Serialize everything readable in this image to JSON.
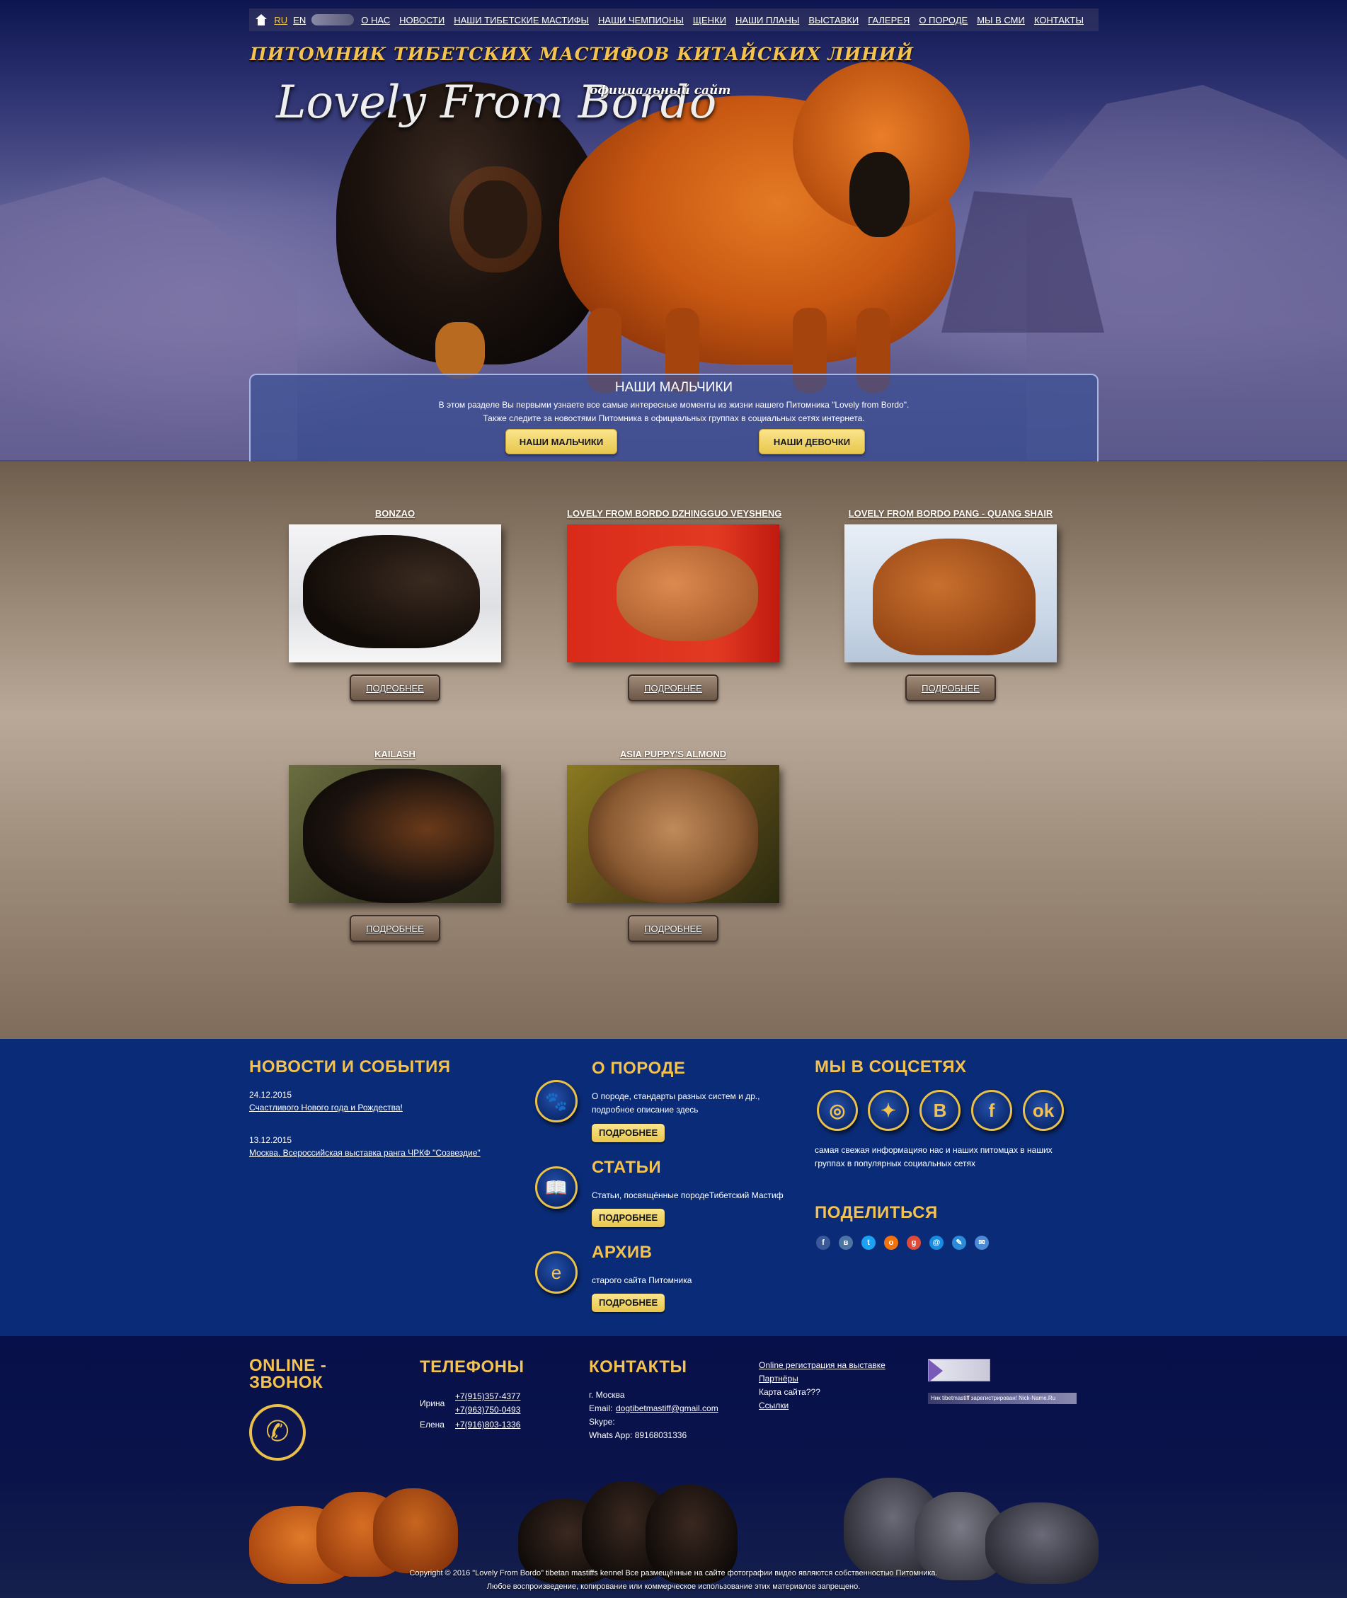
{
  "header": {
    "langs": [
      {
        "label": "RU",
        "active": true
      },
      {
        "label": "EN",
        "active": false
      }
    ],
    "nav": [
      "О НАС",
      "НОВОСТИ",
      "НАШИ ТИБЕТСКИЕ МАСТИФЫ",
      "НАШИ ЧЕМПИОНЫ",
      "ЩЕНКИ",
      "НАШИ ПЛАНЫ",
      "ВЫСТАВКИ",
      "ГАЛЕРЕЯ",
      "О ПОРОДЕ",
      "МЫ В СМИ",
      "КОНТАКТЫ"
    ],
    "kennel_title": "ПИТОМНИК ТИБЕТСКИХ МАСТИФОВ КИТАЙСКИХ ЛИНИЙ",
    "logo": "Lovely From Bordo",
    "official": "официальный сайт"
  },
  "intro": {
    "title": "НАШИ МАЛЬЧИКИ",
    "line1": "В этом разделе Вы первыми узнаете все самые интересные моменты из жизни нашего Питомника \"Lovely from Bordo\".",
    "line2": "Также следите за новостями Питомника в официальных группах в социальных сетях интернета.",
    "btn_boys": "НАШИ МАЛЬЧИКИ",
    "btn_girls": "НАШИ ДЕВОЧКИ"
  },
  "dogs": [
    {
      "name": "BONZAO",
      "more": "ПОДРОБНЕЕ"
    },
    {
      "name": "LOVELY FROM BORDO DZHINGGUO VEYSHENG",
      "more": "ПОДРОБНЕЕ"
    },
    {
      "name": "LOVELY FROM BORDO PANG - QUANG SHAIR",
      "more": "ПОДРОБНЕЕ"
    },
    {
      "name": "KAILASH",
      "more": "ПОДРОБНЕЕ"
    },
    {
      "name": "ASIA PUPPY'S ALMOND",
      "more": "ПОДРОБНЕЕ"
    }
  ],
  "news": {
    "title": "НОВОСТИ И СОБЫТИЯ",
    "items": [
      {
        "date": "24.12.2015",
        "text": "Счастливого Нового года и Рождества!"
      },
      {
        "date": "13.12.2015",
        "text": "Москва. Всероссийская выставка ранга ЧРКФ \"Созвездие\""
      }
    ]
  },
  "about": {
    "title": "О ПОРОДЕ",
    "text1": "О породе, стандарты разных систем и др.,",
    "text2": "подробное описание здесь",
    "btn": "ПОДРОБНЕЕ",
    "icon": "paw-icon"
  },
  "articles": {
    "title": "СТАТЬИ",
    "text": "Статьи, посвящённые породеТибетский Мастиф",
    "btn": "ПОДРОБНЕЕ",
    "icon": "book-icon"
  },
  "archive": {
    "title": "АРХИВ",
    "text": "старого сайта Питомника",
    "btn": "ПОДРОБНЕЕ",
    "icon": "browser-icon"
  },
  "social": {
    "title": "МЫ В СОЦСЕТЯХ",
    "icons": [
      "instagram-icon",
      "twitter-icon",
      "vk-icon",
      "facebook-icon",
      "odnoklassniki-icon"
    ],
    "text1": "самая свежая информацияо нас и наших питомцах в наших",
    "text2": "группах в популярных социальных сетях"
  },
  "share": {
    "title": "ПОДЕЛИТЬСЯ",
    "icons": [
      {
        "name": "facebook-share-icon",
        "color": "#3b5998"
      },
      {
        "name": "vk-share-icon",
        "color": "#4c75a3"
      },
      {
        "name": "twitter-share-icon",
        "color": "#1da1f2"
      },
      {
        "name": "odnoklassniki-share-icon",
        "color": "#f2720c"
      },
      {
        "name": "google-plus-share-icon",
        "color": "#dd4b39"
      },
      {
        "name": "mail-ru-share-icon",
        "color": "#168de2"
      },
      {
        "name": "livejournal-share-icon",
        "color": "#2b8bd6"
      },
      {
        "name": "email-share-icon",
        "color": "#4a8ad6"
      }
    ]
  },
  "footer": {
    "online_title_1": "ONLINE -",
    "online_title_2": "ЗВОНОК",
    "phones_title": "ТЕЛЕФОНЫ",
    "phones": [
      {
        "name": "Ирина",
        "numbers": [
          "+7(915)357-4377",
          "+7(963)750-0493"
        ]
      },
      {
        "name": "Елена",
        "numbers": [
          "+7(916)803-1336"
        ]
      }
    ],
    "contacts_title": "КОНТАКТЫ",
    "city": "г. Москва",
    "email_label": "Email:",
    "email": "dogtibetmastiff@gmail.com",
    "skype": "Skype:",
    "whatsapp": "Whats App: 89168031336",
    "links": [
      "Online регистрация на выставке",
      "Партнёры",
      "Карта сайта???",
      "Ссылки"
    ],
    "counter_text": "Ник tibetmastiff зарегистрирован! Nick-Name.Ru",
    "copyright1": "Copyright © 2016 \"Lovely From Bordo\" tibetan mastiffs kennel Все размещённые на сайте фотографии видео являются собственностью Питомника.",
    "copyright2": "Любое воспроизведение, копирование или коммерческое использование этих материалов запрещено."
  },
  "colors": {
    "accent": "#f4c24e",
    "info_bg": "#0a2c78",
    "footer_bg": "#07104a"
  }
}
